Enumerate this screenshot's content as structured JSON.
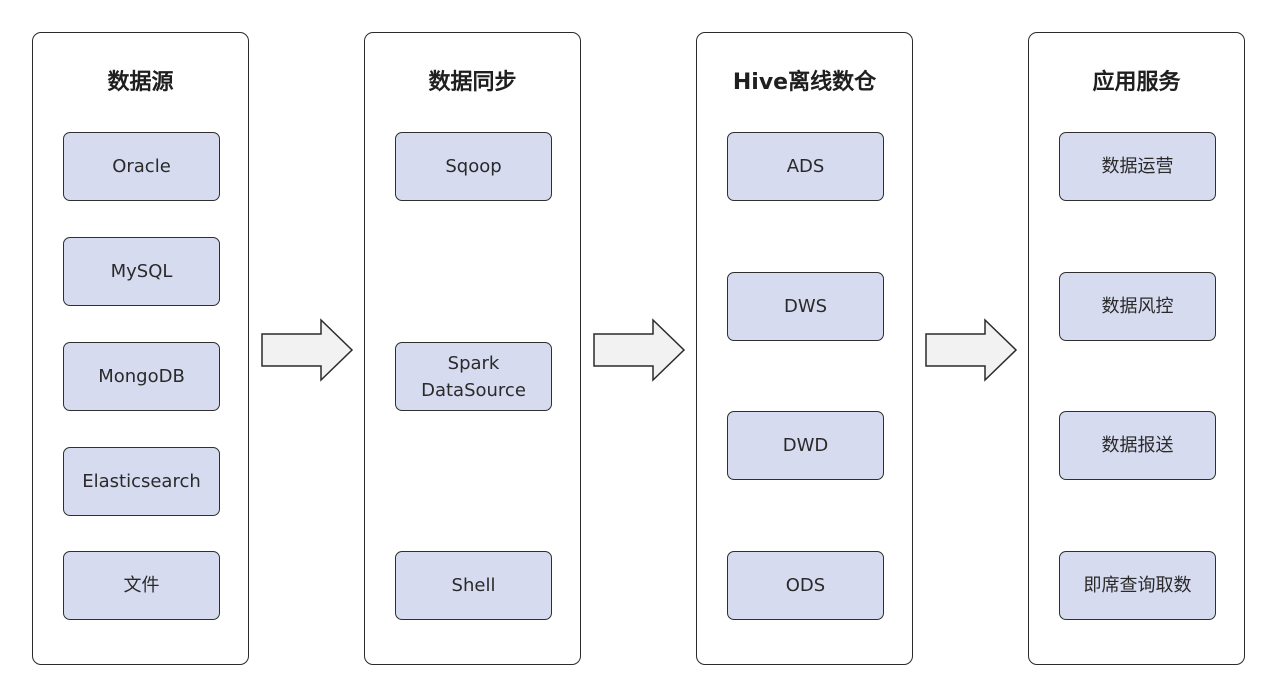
{
  "columns": [
    {
      "title": "数据源",
      "nodes": [
        "Oracle",
        "MySQL",
        "MongoDB",
        "Elasticsearch",
        "文件"
      ]
    },
    {
      "title": "数据同步",
      "nodes": [
        "Sqoop",
        "Spark\nDataSource",
        "Shell"
      ]
    },
    {
      "title": "Hive离线数仓",
      "nodes": [
        "ADS",
        "DWS",
        "DWD",
        "ODS"
      ]
    },
    {
      "title": "应用服务",
      "nodes": [
        "数据运营",
        "数据风控",
        "数据报送",
        "即席查询取数"
      ]
    }
  ],
  "colors": {
    "node_fill": "#d6dbf0",
    "arrow_fill": "#f2f2f2",
    "border": "#2b2b2b"
  }
}
